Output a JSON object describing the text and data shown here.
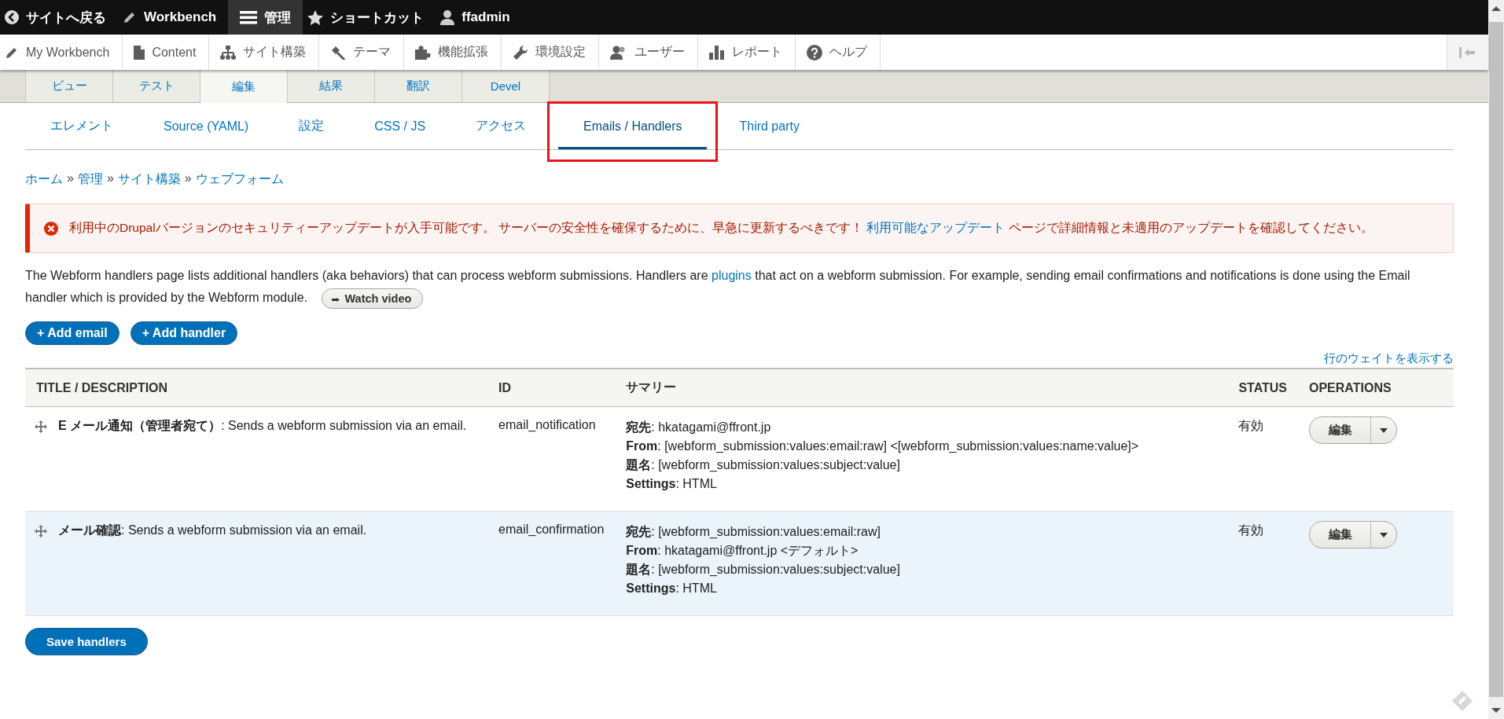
{
  "top_bar": [
    {
      "label": "サイトへ戻る",
      "selected": false
    },
    {
      "label": "Workbench",
      "selected": false
    },
    {
      "label": "管理",
      "selected": true
    },
    {
      "label": "ショートカット",
      "selected": false
    },
    {
      "label": "ffadmin",
      "selected": false
    }
  ],
  "admin_menu": [
    {
      "label": "My Workbench"
    },
    {
      "label": "Content"
    },
    {
      "label": "サイト構築"
    },
    {
      "label": "テーマ"
    },
    {
      "label": "機能拡張"
    },
    {
      "label": "環境設定"
    },
    {
      "label": "ユーザー"
    },
    {
      "label": "レポート"
    },
    {
      "label": "ヘルプ"
    }
  ],
  "primary_tabs": [
    {
      "label": "ビュー",
      "selected": false
    },
    {
      "label": "テスト",
      "selected": false
    },
    {
      "label": "編集",
      "selected": true
    },
    {
      "label": "結果",
      "selected": false
    },
    {
      "label": "翻訳",
      "selected": false
    },
    {
      "label": "Devel",
      "selected": false
    }
  ],
  "secondary_tabs": [
    {
      "label": "エレメント",
      "selected": false,
      "highlighted": false
    },
    {
      "label": "Source (YAML)",
      "selected": false,
      "highlighted": false
    },
    {
      "label": "設定",
      "selected": false,
      "highlighted": false
    },
    {
      "label": "CSS / JS",
      "selected": false,
      "highlighted": false
    },
    {
      "label": "アクセス",
      "selected": false,
      "highlighted": false
    },
    {
      "label": "Emails / Handlers",
      "selected": true,
      "highlighted": true
    },
    {
      "label": "Third party",
      "selected": false,
      "highlighted": false
    }
  ],
  "breadcrumb": [
    "ホーム",
    "管理",
    "サイト構築",
    "ウェブフォーム"
  ],
  "breadcrumb_separator": "»",
  "error_message": {
    "before": "利用中のDrupalバージョンのセキュリティーアップデートが入手可能です。 サーバーの安全性を確保するために、早急に更新するべきです！ ",
    "link": "利用可能なアップデート",
    "after": " ページで詳細情報と未適用のアップデートを確認してください。"
  },
  "intro": {
    "before": "The Webform handlers page lists additional handlers (aka behaviors) that can process webform submissions. Handlers are ",
    "link": "plugins",
    "after": " that act on a webform submission. For example, sending email confirmations and notifications is done using the Email handler which is provided by the Webform module.",
    "video_button": "Watch video"
  },
  "action_buttons": [
    "+ Add email",
    "+ Add handler"
  ],
  "show_weights_link": "行のウェイトを表示する",
  "table": {
    "columns": [
      "TITLE / DESCRIPTION",
      "ID",
      "サマリー",
      "STATUS",
      "OPERATIONS"
    ],
    "rows": [
      {
        "title": "E メール通知（管理者宛て）",
        "description": ": Sends a webform submission via an email.",
        "id": "email_notification",
        "highlighted": false,
        "summary": [
          {
            "label": "宛先",
            "value": ": hkatagami@ffront.jp"
          },
          {
            "label": "From",
            "value": ": [webform_submission:values:email:raw] <[webform_submission:values:name:value]>"
          },
          {
            "label": "題名",
            "value": ": [webform_submission:values:subject:value]"
          },
          {
            "label": "Settings",
            "value": ": HTML"
          }
        ],
        "status": "有効",
        "operation": "編集"
      },
      {
        "title": "メール確認",
        "description": ": Sends a webform submission via an email.",
        "id": "email_confirmation",
        "highlighted": true,
        "summary": [
          {
            "label": "宛先",
            "value": ": [webform_submission:values:email:raw]"
          },
          {
            "label": "From",
            "value": ": hkatagami@ffront.jp <デフォルト>"
          },
          {
            "label": "題名",
            "value": ": [webform_submission:values:subject:value]"
          },
          {
            "label": "Settings",
            "value": ": HTML"
          }
        ],
        "status": "有効",
        "operation": "編集"
      }
    ]
  },
  "save_button": "Save handlers"
}
